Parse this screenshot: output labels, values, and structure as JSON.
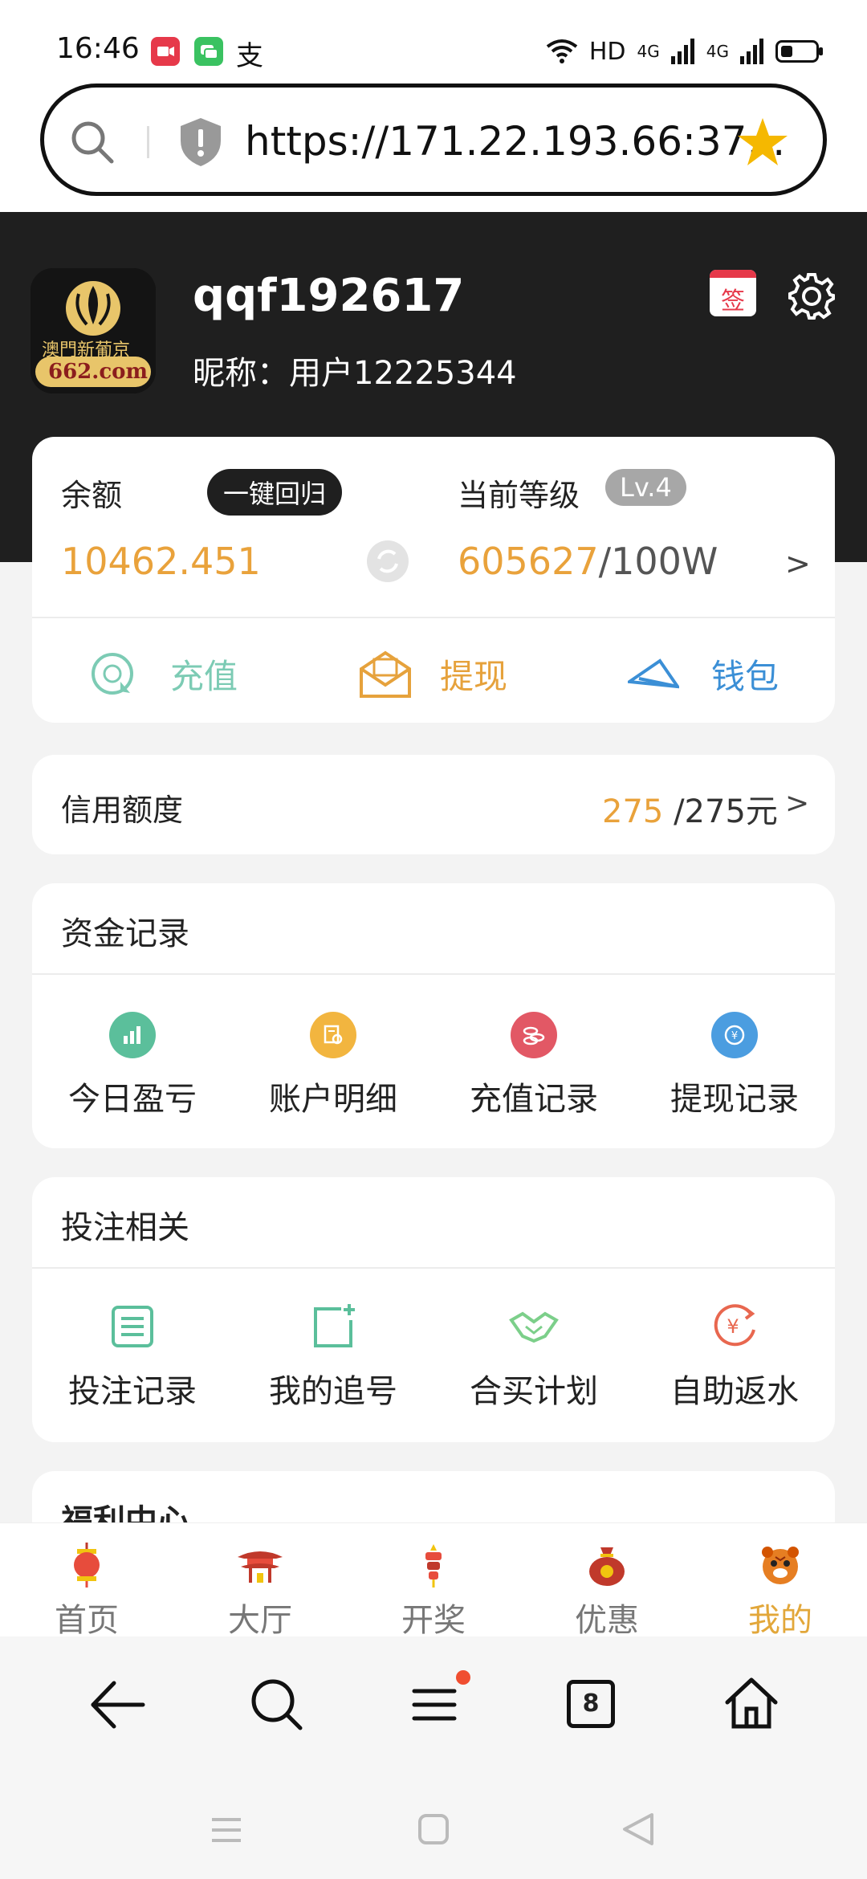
{
  "status_bar": {
    "time": "16:46",
    "hd_label": "HD",
    "net1": "4G",
    "net2": "4G"
  },
  "browser": {
    "url": "https://171.22.193.66:37...",
    "tab_count": "8",
    "menu_has_notification": true
  },
  "profile": {
    "username": "qqf192617",
    "nickname": "昵称：用户12225344",
    "logo_text": "澳門新葡京",
    "logo_domain": "662.com",
    "signin_label": "签"
  },
  "balance": {
    "label": "余额",
    "one_key_return": "一键回归",
    "amount": "10462.451",
    "level_label": "当前等级",
    "level_badge": "Lv.4",
    "level_progress": "605627",
    "level_target": "/100W",
    "arrow": ">"
  },
  "actions": [
    {
      "label": "充值",
      "color": "#7ccbb4",
      "icon": "recharge-icon"
    },
    {
      "label": "提现",
      "color": "#e6a23c",
      "icon": "withdraw-icon"
    },
    {
      "label": "钱包",
      "color": "#3b8fd6",
      "icon": "wallet-icon"
    }
  ],
  "credit": {
    "label": "信用额度",
    "used": "275",
    "total": "/275元",
    "arrow": ">"
  },
  "funds_records": {
    "title": "资金记录",
    "items": [
      {
        "label": "今日盈亏",
        "icon": "chart-icon",
        "color": "#5bbf9b"
      },
      {
        "label": "账户明细",
        "icon": "account-detail-icon",
        "color": "#f2b53f"
      },
      {
        "label": "充值记录",
        "icon": "coins-icon",
        "color": "#e25865"
      },
      {
        "label": "提现记录",
        "icon": "yuan-refresh-icon",
        "color": "#4b9de0"
      }
    ]
  },
  "bet_related": {
    "title": "投注相关",
    "items": [
      {
        "label": "投注记录",
        "icon": "list-icon",
        "color": "#5bbf9b"
      },
      {
        "label": "我的追号",
        "icon": "add-note-icon",
        "color": "#5bbf9b"
      },
      {
        "label": "合买计划",
        "icon": "handshake-icon",
        "color": "#7ccf8a"
      },
      {
        "label": "自助返水",
        "icon": "yuan-return-icon",
        "color": "#e8674f"
      }
    ]
  },
  "welfare": {
    "title": "福利中心"
  },
  "bottom_nav": [
    {
      "label": "首页",
      "icon": "lantern-icon",
      "active": false
    },
    {
      "label": "大厅",
      "icon": "pavilion-icon",
      "active": false
    },
    {
      "label": "开奖",
      "icon": "firecracker-icon",
      "active": false
    },
    {
      "label": "优惠",
      "icon": "lucky-bag-icon",
      "active": false
    },
    {
      "label": "我的",
      "icon": "tiger-icon",
      "active": true
    }
  ]
}
